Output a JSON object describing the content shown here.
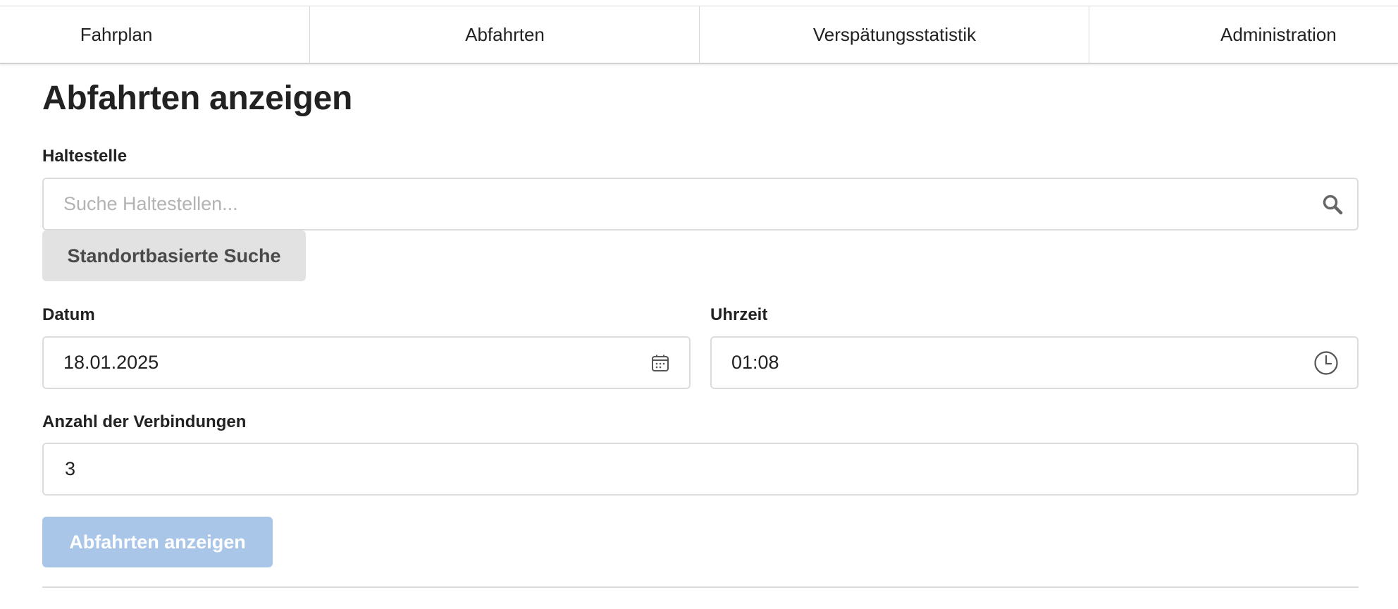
{
  "nav": {
    "tabs": [
      {
        "label": "Fahrplan"
      },
      {
        "label": "Abfahrten"
      },
      {
        "label": "Verspätungsstatistik"
      },
      {
        "label": "Administration"
      }
    ]
  },
  "page": {
    "title": "Abfahrten anzeigen"
  },
  "form": {
    "stop": {
      "label": "Haltestelle",
      "placeholder": "Suche Haltestellen...",
      "value": "",
      "icon": "search-icon"
    },
    "location_button_label": "Standortbasierte Suche",
    "date": {
      "label": "Datum",
      "value": "18.01.2025",
      "icon": "calendar-icon"
    },
    "time": {
      "label": "Uhrzeit",
      "value": "01:08",
      "icon": "clock-icon"
    },
    "connections": {
      "label": "Anzahl der Verbindungen",
      "value": "3"
    },
    "submit_label": "Abfahrten anzeigen"
  },
  "colors": {
    "primary_button_disabled": "#a9c6e8",
    "secondary_button": "#e2e2e3",
    "border": "#dcdcdc",
    "text": "#222222"
  }
}
